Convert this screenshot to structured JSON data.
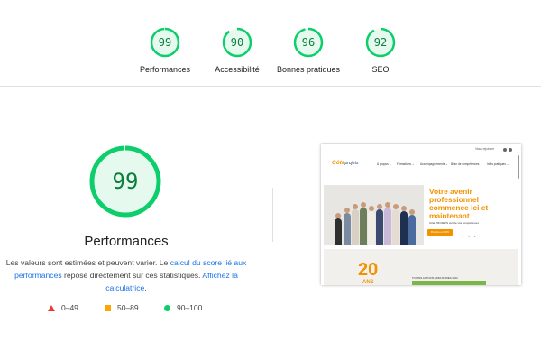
{
  "categories": [
    {
      "label": "Performances",
      "score": "99",
      "fraction": 0.99
    },
    {
      "label": "Accessibilité",
      "score": "90",
      "fraction": 0.9
    },
    {
      "label": "Bonnes pratiques",
      "score": "96",
      "fraction": 0.96
    },
    {
      "label": "SEO",
      "score": "92",
      "fraction": 0.92
    }
  ],
  "main": {
    "score": "99",
    "fraction": 0.99,
    "title": "Performances",
    "desc_part1": "Les valeurs sont estimées et peuvent varier. Le ",
    "desc_link1": "calcul du score lié aux performances",
    "desc_part2": " repose directement sur ces statistiques. ",
    "desc_link2": "Affichez la calculatrice",
    "desc_end": "."
  },
  "legend": {
    "fail": "0–49",
    "average": "50–89",
    "pass": "90–100"
  },
  "colors": {
    "pass": "#0cce6b",
    "pass_text": "#0a7e3a",
    "pass_bg": "#e6f9ef",
    "average": "#ffa400",
    "fail": "#eb3b2e",
    "link": "#1a73e8",
    "brand_orange": "#f39200"
  },
  "thumbnail": {
    "topbar_link": "Nous rejoindre",
    "logo_main": "Côté",
    "logo_sub": "projets",
    "nav": [
      "À propos ⌄",
      "Formations ⌄",
      "Accompagnements ⌄",
      "Bilan de compétences ⌄",
      "Infos pratiques ⌄"
    ],
    "hero_line1": "Votre avenir",
    "hero_line2": "professionnel",
    "hero_line3": "commence ici et",
    "hero_line4": "maintenant",
    "hero_sub": "Côté PROJETS certifie vos compétences",
    "hero_button": "Prendre un RDV",
    "hero_dots": "• • •",
    "anniv_number": "20",
    "anniv_word": "ANS",
    "news_label": "TOUTES ACTIONS | INDUSTRIES 2024"
  }
}
